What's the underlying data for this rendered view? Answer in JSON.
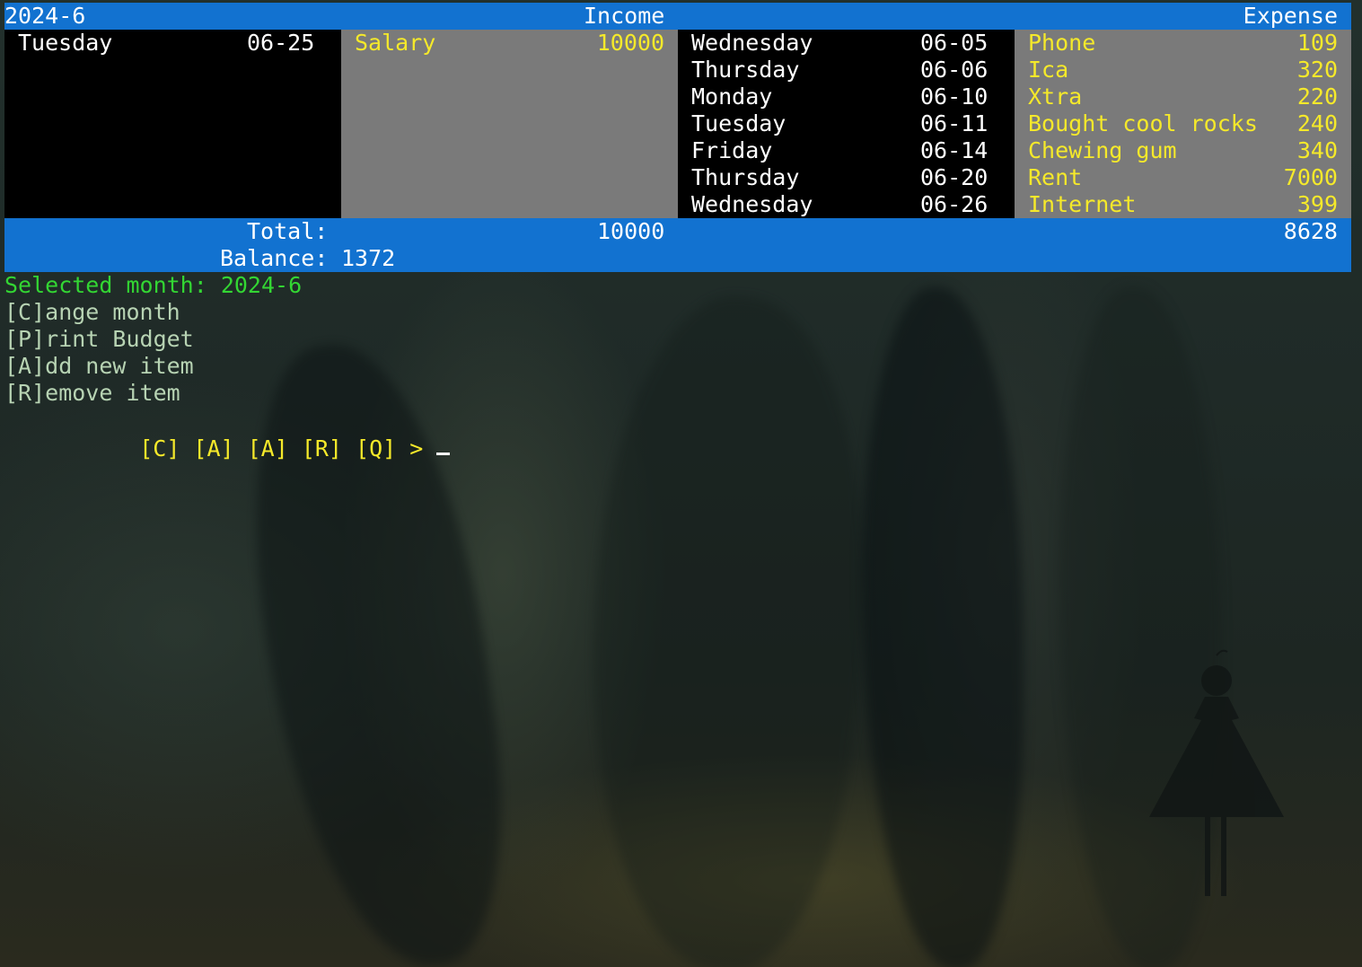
{
  "header": {
    "month": "2024-6",
    "income_label": "Income",
    "expense_label": "Expense"
  },
  "income": {
    "dates": [
      {
        "day": "Tuesday",
        "date": "06-25"
      }
    ],
    "items": [
      {
        "name": "Salary",
        "amount": "10000"
      }
    ]
  },
  "expense": {
    "dates": [
      {
        "day": "Wednesday",
        "date": "06-05"
      },
      {
        "day": "Thursday",
        "date": "06-06"
      },
      {
        "day": "Monday",
        "date": "06-10"
      },
      {
        "day": "Tuesday",
        "date": "06-11"
      },
      {
        "day": "Friday",
        "date": "06-14"
      },
      {
        "day": "Thursday",
        "date": "06-20"
      },
      {
        "day": "Wednesday",
        "date": "06-26"
      }
    ],
    "items": [
      {
        "name": "Phone",
        "amount": "109"
      },
      {
        "name": "Ica",
        "amount": "320"
      },
      {
        "name": "Xtra",
        "amount": "220"
      },
      {
        "name": "Bought cool rocks",
        "amount": "240"
      },
      {
        "name": "Chewing gum",
        "amount": "340"
      },
      {
        "name": "Rent",
        "amount": "7000"
      },
      {
        "name": "Internet",
        "amount": "399"
      }
    ]
  },
  "totals": {
    "total_label": "Total:",
    "income_total": "10000",
    "expense_total": "8628",
    "balance_label": "Balance:",
    "balance_value": "1372"
  },
  "menu": {
    "selected_month": "Selected month: 2024-6",
    "change_month": "[C]ange month",
    "print_budget": "[P]rint Budget",
    "add_item": "[A]dd new item",
    "remove_item": "[R]emove item"
  },
  "prompt": {
    "text": "[C] [A] [A] [R] [Q] > "
  },
  "colors": {
    "bar": "#1272d0",
    "grey_panel": "#7a7a7a",
    "highlight_text": "#f5e92a",
    "menu_title": "#33d633"
  }
}
